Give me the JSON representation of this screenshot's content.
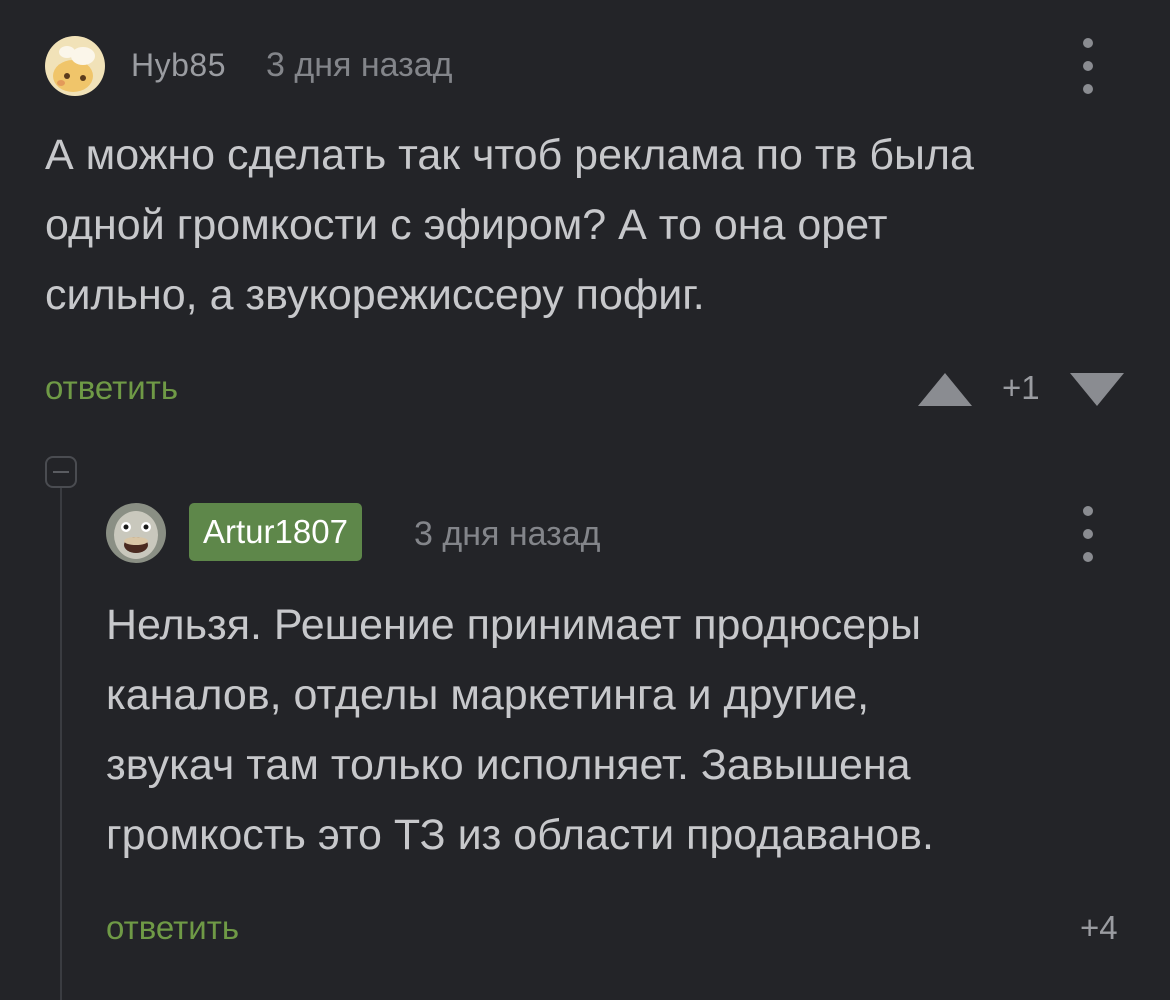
{
  "comments": [
    {
      "author": "Hyb85",
      "time": "3 дня назад",
      "lines": [
        "А можно сделать так чтоб реклама по тв была",
        "одной громкости с эфиром? А то она орет",
        "сильно, а звукорежиссеру пофиг."
      ],
      "reply_label": "ответить",
      "rating": "+1",
      "avatar_icon": "cartoon-face-avatar"
    },
    {
      "author": "Artur1807",
      "author_badge_color": "#5e874a",
      "time": "3 дня назад",
      "lines": [
        "Нельзя. Решение принимает продюсеры",
        "каналов, отделы маркетинга и другие,",
        "звукач там только исполняет. Завышена",
        "громкость это ТЗ из области продаванов."
      ],
      "reply_label": "ответить",
      "rating": "+4",
      "avatar_icon": "ostrich-avatar"
    }
  ],
  "colors": {
    "background": "#232428",
    "reply_link": "#6f9a46",
    "muted_text": "#83858a"
  }
}
